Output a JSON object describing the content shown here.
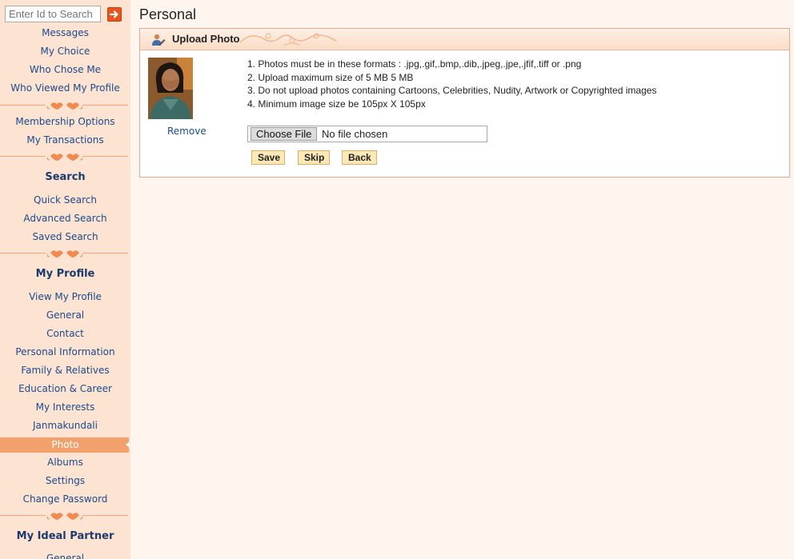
{
  "search": {
    "placeholder": "Enter Id to Search"
  },
  "sidebar": {
    "group1": [
      "Messages",
      "My Choice",
      "Who Chose Me",
      "Who Viewed My Profile"
    ],
    "group2": [
      "Membership Options",
      "My Transactions"
    ],
    "search_heading": "Search",
    "group3": [
      "Quick Search",
      "Advanced Search",
      "Saved Search"
    ],
    "profile_heading": "My Profile",
    "group4": [
      "View My Profile",
      "General",
      "Contact",
      "Personal Information",
      "Family & Relatives",
      "Education & Career",
      "My Interests",
      "Janmakundali",
      "Photo",
      "Albums",
      "Settings",
      "Change Password"
    ],
    "partner_heading": "My Ideal Partner",
    "group5": [
      "General"
    ],
    "active_item": "Photo"
  },
  "main": {
    "page_title": "Personal",
    "panel_title": "Upload Photo",
    "remove_label": "Remove",
    "rules": [
      "1. Photos must be in these formats : .jpg,.gif,.bmp,.dib,.jpeg,.jpe,.jfif,.tiff or .png",
      "2. Upload maximum size of 5 MB 5  MB",
      "3. Do not upload photos containing Cartoons, Celebrities, Nudity, Artwork or Copyrighted images",
      "4. Minimum image size be  105px X 105px"
    ],
    "file_button_label": "Choose File",
    "file_status": "No file chosen",
    "save_label": "Save",
    "skip_label": "Skip",
    "back_label": "Back"
  },
  "colors": {
    "sidebar_bg": "#fde3d1",
    "active_bg": "#f2a06c",
    "link": "#1a4a8c",
    "button_bg": "#fde9b5",
    "page_bg": "#fef5ee"
  }
}
